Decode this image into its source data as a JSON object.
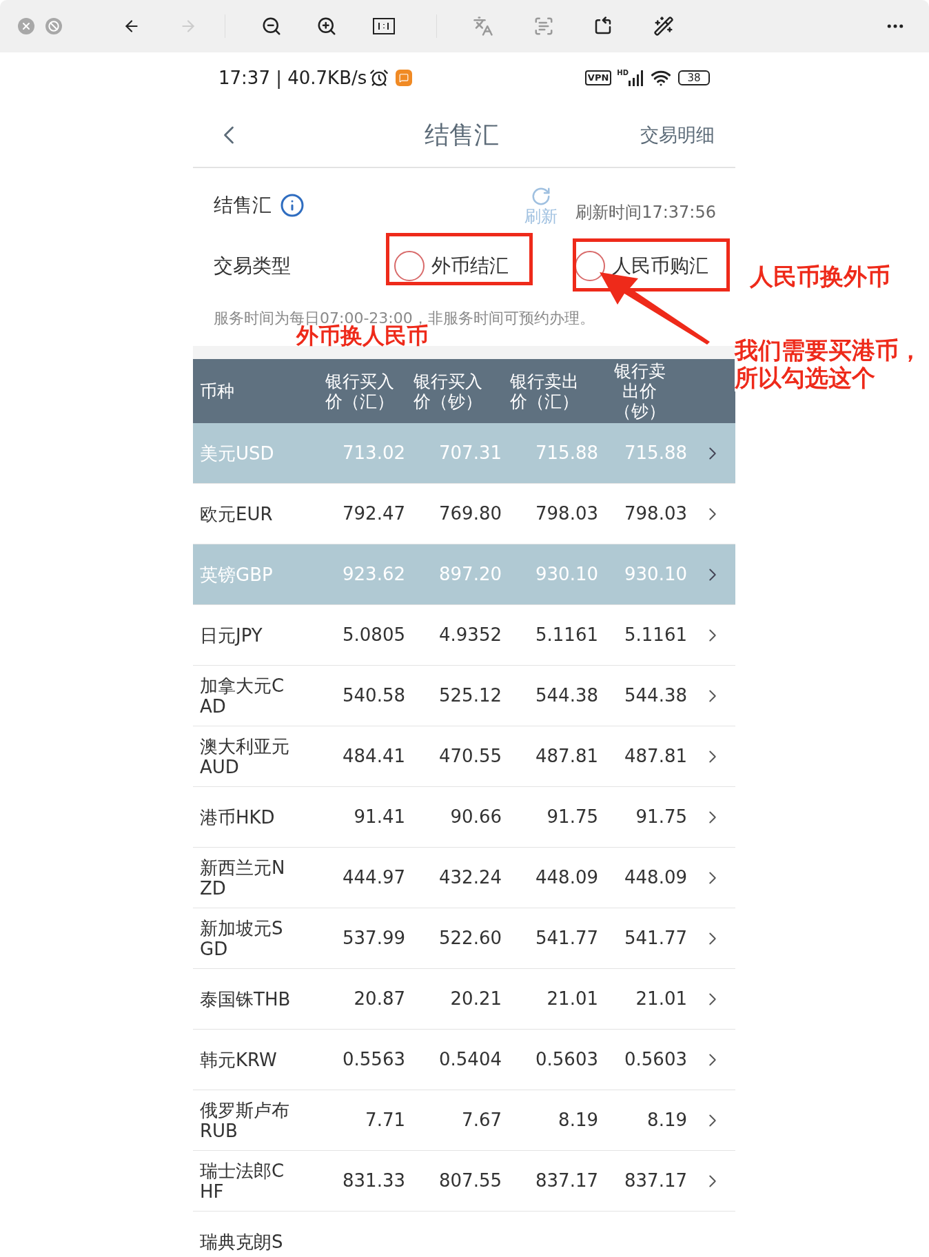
{
  "status_bar": {
    "time_speed": "17:37 | 40.7KB/s",
    "vpn": "VPN",
    "signal_badge": "HD",
    "battery": "38"
  },
  "nav": {
    "title": "结售汇",
    "right_link": "交易明细"
  },
  "panel": {
    "label": "结售汇",
    "refresh_label": "刷新",
    "refresh_time": "刷新时间17:37:56",
    "type_label": "交易类型",
    "options": [
      {
        "label": "外币结汇",
        "selected": false
      },
      {
        "label": "人民币购汇",
        "selected": false
      }
    ],
    "notice": "服务时间为每日07:00-23:00，非服务时间可预约办理。"
  },
  "annotations": [
    {
      "kind": "label",
      "text": "人民币换外币"
    },
    {
      "kind": "label",
      "text": "外币换人民币"
    },
    {
      "kind": "note",
      "text": "我们需要买港币，所以勾选这个"
    }
  ],
  "table": {
    "columns": [
      "币种",
      "银行买入价（汇）",
      "银行买入价（钞）",
      "银行卖出价（汇）",
      "银行卖出价（钞）"
    ],
    "rows": [
      {
        "highlighted": true,
        "cells": [
          "美元USD",
          "713.02",
          "707.31",
          "715.88",
          "715.88"
        ]
      },
      {
        "highlighted": false,
        "cells": [
          "欧元EUR",
          "792.47",
          "769.80",
          "798.03",
          "798.03"
        ]
      },
      {
        "highlighted": true,
        "cells": [
          "英镑GBP",
          "923.62",
          "897.20",
          "930.10",
          "930.10"
        ]
      },
      {
        "highlighted": false,
        "cells": [
          "日元JPY",
          "5.0805",
          "4.9352",
          "5.1161",
          "5.1161"
        ]
      },
      {
        "highlighted": false,
        "cells": [
          "加拿大元CAD",
          "540.58",
          "525.12",
          "544.38",
          "544.38"
        ]
      },
      {
        "highlighted": false,
        "cells": [
          "澳大利亚元AUD",
          "484.41",
          "470.55",
          "487.81",
          "487.81"
        ]
      },
      {
        "highlighted": false,
        "cells": [
          "港币HKD",
          "91.41",
          "90.66",
          "91.75",
          "91.75"
        ]
      },
      {
        "highlighted": false,
        "cells": [
          "新西兰元NZD",
          "444.97",
          "432.24",
          "448.09",
          "448.09"
        ]
      },
      {
        "highlighted": false,
        "cells": [
          "新加坡元SGD",
          "537.99",
          "522.60",
          "541.77",
          "541.77"
        ]
      },
      {
        "highlighted": false,
        "cells": [
          "泰国铢THB",
          "20.87",
          "20.21",
          "21.01",
          "21.01"
        ]
      },
      {
        "highlighted": false,
        "cells": [
          "韩元KRW",
          "0.5563",
          "0.5404",
          "0.5603",
          "0.5603"
        ]
      },
      {
        "highlighted": false,
        "cells": [
          "俄罗斯卢布RUB",
          "7.71",
          "7.67",
          "8.19",
          "8.19"
        ]
      },
      {
        "highlighted": false,
        "cells": [
          "瑞士法郎CHF",
          "831.33",
          "807.55",
          "837.17",
          "837.17"
        ]
      },
      {
        "highlighted": false,
        "cells": [
          "瑞典克朗S"
        ]
      }
    ]
  }
}
